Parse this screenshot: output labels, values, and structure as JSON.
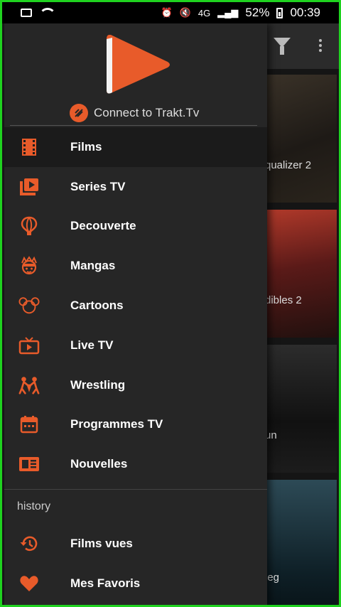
{
  "status_bar": {
    "battery_percent": "52%",
    "time": "00:39",
    "network": "4G"
  },
  "brand": {
    "accent": "#e85b2a",
    "trakt_label": "Connect to Trakt.Tv"
  },
  "menu": {
    "items": [
      {
        "label": "Films",
        "icon": "film-strip-icon",
        "selected": true
      },
      {
        "label": "Series TV",
        "icon": "play-stack-icon"
      },
      {
        "label": "Decouverte",
        "icon": "balloon-icon"
      },
      {
        "label": "Mangas",
        "icon": "anime-face-icon"
      },
      {
        "label": "Cartoons",
        "icon": "mickey-ears-icon"
      },
      {
        "label": "Live TV",
        "icon": "tv-icon"
      },
      {
        "label": "Wrestling",
        "icon": "wrestlers-icon"
      },
      {
        "label": "Programmes TV",
        "icon": "calendar-icon"
      },
      {
        "label": "Nouvelles",
        "icon": "newspaper-icon"
      }
    ],
    "history_title": "history",
    "history_items": [
      {
        "label": "Films vues",
        "icon": "history-clock-icon"
      },
      {
        "label": "Mes Favoris",
        "icon": "heart-icon"
      }
    ]
  },
  "background_posters": [
    {
      "title": "qualizer 2"
    },
    {
      "title": "dibles 2"
    },
    {
      "title": "un"
    },
    {
      "title": "leg"
    }
  ]
}
